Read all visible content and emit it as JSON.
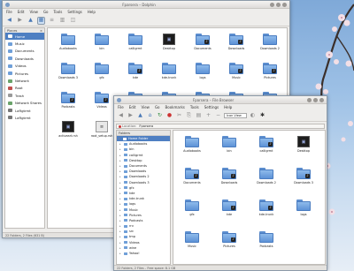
{
  "dolphin": {
    "title": "Fparsera – Dolphin",
    "menu": [
      "File",
      "Edit",
      "View",
      "Go",
      "Tools",
      "Settings",
      "Help"
    ],
    "location": "Home",
    "places_header": "Places",
    "places": [
      "Home",
      "Music",
      "Documents",
      "Downloads",
      "Videos",
      "Pictures",
      "Network",
      "Root",
      "Trash",
      "Network Shares",
      "LaRgtrmt",
      "LaRgtrmt"
    ],
    "files": [
      {
        "name": "Audiobooks",
        "kind": "folder"
      },
      {
        "name": "bin",
        "kind": "folder"
      },
      {
        "name": "calligrmt",
        "kind": "folder"
      },
      {
        "name": "Desktop",
        "kind": "dark"
      },
      {
        "name": "Documents",
        "kind": "folder-emb"
      },
      {
        "name": "Downloads",
        "kind": "folder-emb"
      },
      {
        "name": "Downloads 2",
        "kind": "folder"
      },
      {
        "name": "Downloads 3",
        "kind": "folder"
      },
      {
        "name": "gfx",
        "kind": "folder"
      },
      {
        "name": "kde",
        "kind": "folder-emb"
      },
      {
        "name": "kde-trunk",
        "kind": "folder"
      },
      {
        "name": "logs",
        "kind": "folder"
      },
      {
        "name": "Music",
        "kind": "folder-emb"
      },
      {
        "name": "Pictures",
        "kind": "folder-emb"
      },
      {
        "name": "Podcasts",
        "kind": "folder-emb"
      },
      {
        "name": "Videos",
        "kind": "folder-emb"
      },
      {
        "name": "wine",
        "kind": "folder"
      },
      {
        "name": "",
        "kind": "folder"
      },
      {
        "name": "",
        "kind": "folder"
      },
      {
        "name": "",
        "kind": "folder"
      },
      {
        "name": "",
        "kind": "folder"
      },
      {
        "name": "activeart.rsh",
        "kind": "dark"
      },
      {
        "name": "root_setup.rsh",
        "kind": "light"
      }
    ],
    "status": "22 Folders, 2 Files (631 B)"
  },
  "konqueror": {
    "title": "Fparsera – File Browser",
    "menu": [
      "File",
      "Edit",
      "View",
      "Go",
      "Bookmarks",
      "Tools",
      "Settings",
      "Help"
    ],
    "location_label": "Location:",
    "location": "Fparsera",
    "zoom": "Icon View",
    "tree_tab": "Folders",
    "tree_root": "Home Folder",
    "tree": [
      "Audiobooks",
      "bin",
      "calligrmt",
      "Desktop",
      "Documents",
      "Downloads",
      "Downloads 2",
      "Downloads 3",
      "gfx",
      "kde",
      "kde-trunk",
      "logs",
      "Music",
      "Pictures",
      "Podcasts",
      "rrv",
      "src",
      "tmp",
      "Videos",
      "wine",
      "Yahoo!"
    ],
    "files": [
      {
        "name": "Audiobooks",
        "kind": "folder"
      },
      {
        "name": "bin",
        "kind": "folder"
      },
      {
        "name": "calligrmt",
        "kind": "folder-emb"
      },
      {
        "name": "Desktop",
        "kind": "dark"
      },
      {
        "name": "Documents",
        "kind": "folder-emb"
      },
      {
        "name": "Downloads",
        "kind": "folder-emb"
      },
      {
        "name": "Downloads 2",
        "kind": "folder"
      },
      {
        "name": "Downloads 3",
        "kind": "folder-emb"
      },
      {
        "name": "gfx",
        "kind": "folder"
      },
      {
        "name": "kde",
        "kind": "folder-emb"
      },
      {
        "name": "kde-trunk",
        "kind": "folder-emb"
      },
      {
        "name": "logs",
        "kind": "folder"
      },
      {
        "name": "Music",
        "kind": "folder"
      },
      {
        "name": "Pictures",
        "kind": "folder-emb"
      },
      {
        "name": "Podcasts",
        "kind": "folder"
      }
    ],
    "status": "22 Folders, 2 Files – Free space: 8.1 GB"
  }
}
